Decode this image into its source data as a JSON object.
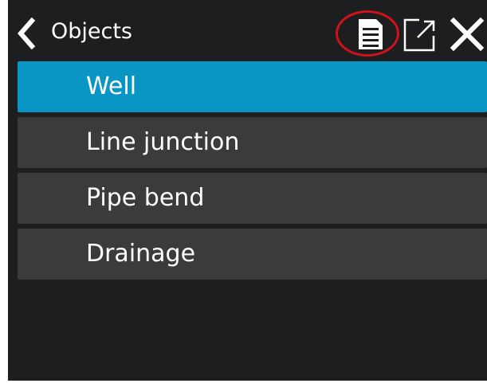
{
  "header": {
    "title": "Objects",
    "back_icon": "chevron-left-icon",
    "list_icon": "document-list-icon",
    "export_icon": "external-link-icon",
    "close_icon": "close-icon",
    "highlight_color": "#d0121b"
  },
  "list": {
    "items": [
      {
        "label": "Well",
        "selected": true
      },
      {
        "label": "Line junction",
        "selected": false
      },
      {
        "label": "Pipe bend",
        "selected": false
      },
      {
        "label": "Drainage",
        "selected": false
      }
    ]
  },
  "colors": {
    "background": "#1c1e20",
    "item": "#3a3b3c",
    "selected": "#0a96c4",
    "text": "#ffffff"
  }
}
